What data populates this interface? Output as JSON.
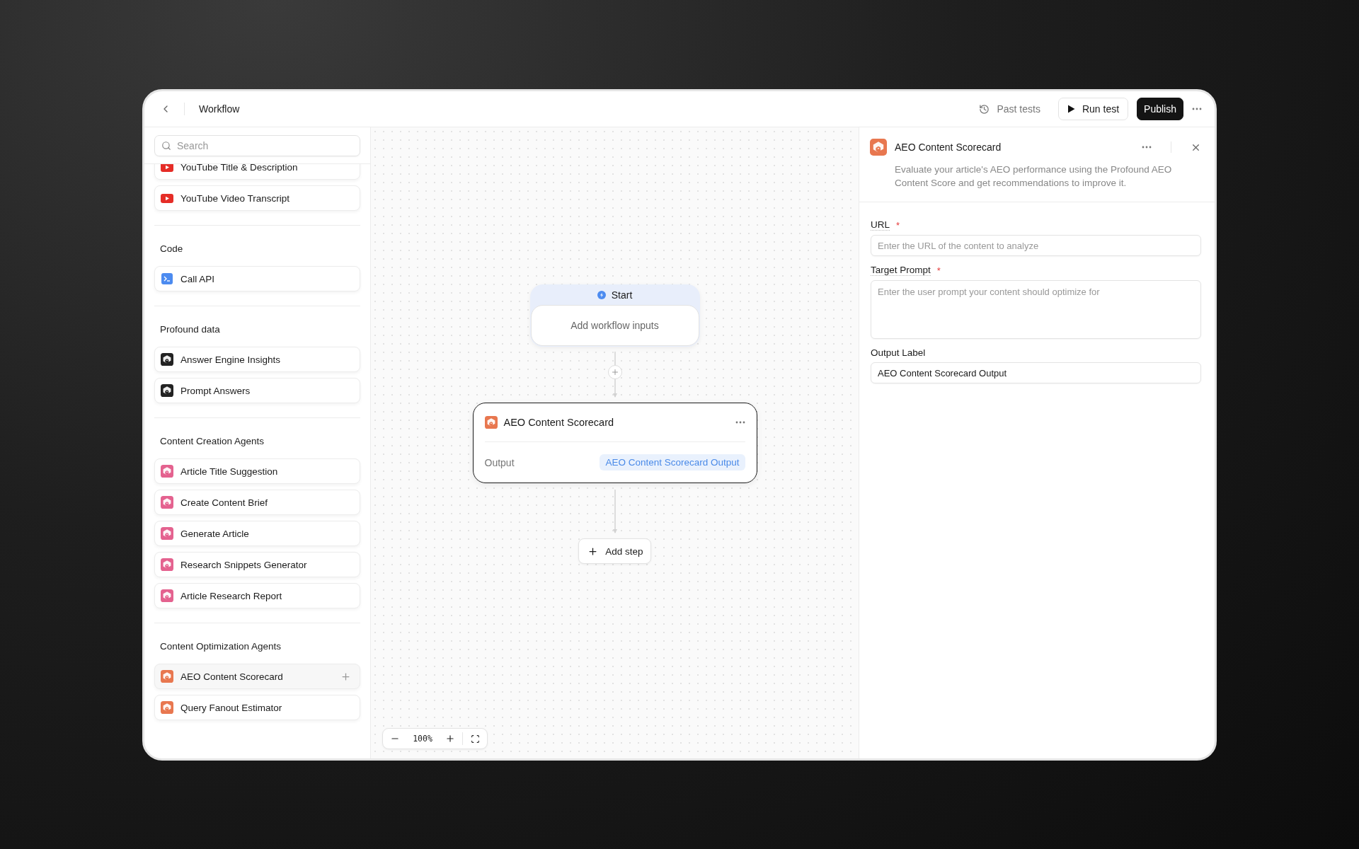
{
  "topbar": {
    "title": "Workflow",
    "actions": [
      {
        "label": "Past tests",
        "kind": "ghost"
      },
      {
        "label": "Run test",
        "kind": "outline"
      },
      {
        "label": "Publish",
        "kind": "primary"
      }
    ]
  },
  "sidebar": {
    "search": {
      "placeholder": "Search"
    },
    "sections": [
      {
        "items": [
          {
            "label": "YouTube Title & Description",
            "kind": "youtube",
            "hovered": false
          },
          {
            "label": "YouTube Video Transcript",
            "kind": "youtube",
            "hovered": false
          }
        ]
      },
      {
        "heading": "Code",
        "items": [
          {
            "label": "Call API",
            "kind": "terminal",
            "hovered": false
          }
        ]
      },
      {
        "heading": "Profound data",
        "items": [
          {
            "label": "Answer Engine Insights",
            "kind": "logo",
            "color": "#222222",
            "hovered": false
          },
          {
            "label": "Prompt Answers",
            "kind": "logo",
            "color": "#222222",
            "hovered": false
          }
        ]
      },
      {
        "heading": "Content Creation Agents",
        "items": [
          {
            "label": "Article Title Suggestion",
            "kind": "logo",
            "color": "#e4628f",
            "hovered": false
          },
          {
            "label": "Create Content Brief",
            "kind": "logo",
            "color": "#e4628f",
            "hovered": false
          },
          {
            "label": "Generate Article",
            "kind": "logo",
            "color": "#e4628f",
            "hovered": false
          },
          {
            "label": "Research Snippets Generator",
            "kind": "logo",
            "color": "#e4628f",
            "hovered": false
          },
          {
            "label": "Article Research Report",
            "kind": "logo",
            "color": "#e4628f",
            "hovered": false
          }
        ]
      },
      {
        "heading": "Content Optimization Agents",
        "items": [
          {
            "label": "AEO Content Scorecard",
            "kind": "logo",
            "color": "#e8774f",
            "hovered": true
          },
          {
            "label": "Query Fanout Estimator",
            "kind": "logo",
            "color": "#e8774f",
            "hovered": false
          }
        ]
      }
    ]
  },
  "canvas": {
    "start": {
      "title": "Start",
      "body": "Add workflow inputs"
    },
    "step": {
      "title": "AEO Content Scorecard",
      "selected": true,
      "output_label": "Output",
      "output_value": "AEO Content Scorecard Output"
    },
    "add_step": "Add step",
    "zoom": "100%"
  },
  "panel": {
    "title": "AEO Content Scorecard",
    "description": "Evaluate your article's AEO performance using the Profound AEO Content Score and get recommendations to improve it.",
    "required_mark": "*",
    "fields": [
      {
        "label": "URL",
        "required": true,
        "kind": "input",
        "placeholder": "Enter the URL of the content to analyze"
      },
      {
        "label": "Target Prompt",
        "required": true,
        "kind": "textarea",
        "placeholder": "Enter the user prompt your content should optimize for"
      },
      {
        "label": "Output Label",
        "required": false,
        "kind": "input",
        "value": "AEO Content Scorecard Output"
      }
    ]
  }
}
